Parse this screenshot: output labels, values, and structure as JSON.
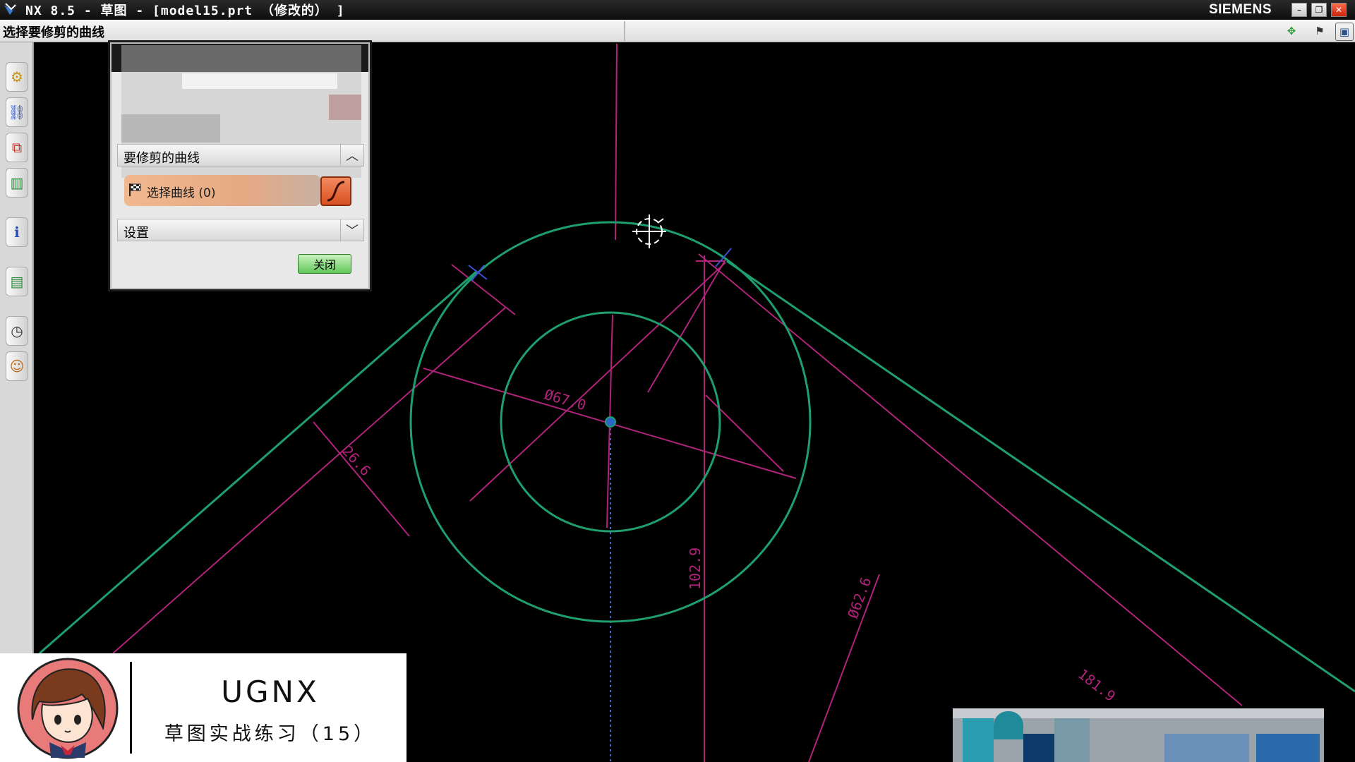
{
  "window": {
    "title": "NX 8.5 - 草图 - [model15.prt （修改的） ]",
    "brand": "SIEMENS"
  },
  "cue": {
    "text": "选择要修剪的曲线"
  },
  "dialog": {
    "section_curves": "要修剪的曲线",
    "select_label": "选择曲线 (0)",
    "section_settings": "设置",
    "close_label": "关闭"
  },
  "sketch": {
    "dimensions": [
      "Ø67.0",
      "26.6",
      "102.9",
      "Ø62.6",
      "181.9"
    ],
    "colors": {
      "curve": "#1f9f6e",
      "dimension": "#b0237a",
      "background": "#000000"
    }
  },
  "card": {
    "title": "UGNX",
    "subtitle": "草图实战练习（15）"
  }
}
